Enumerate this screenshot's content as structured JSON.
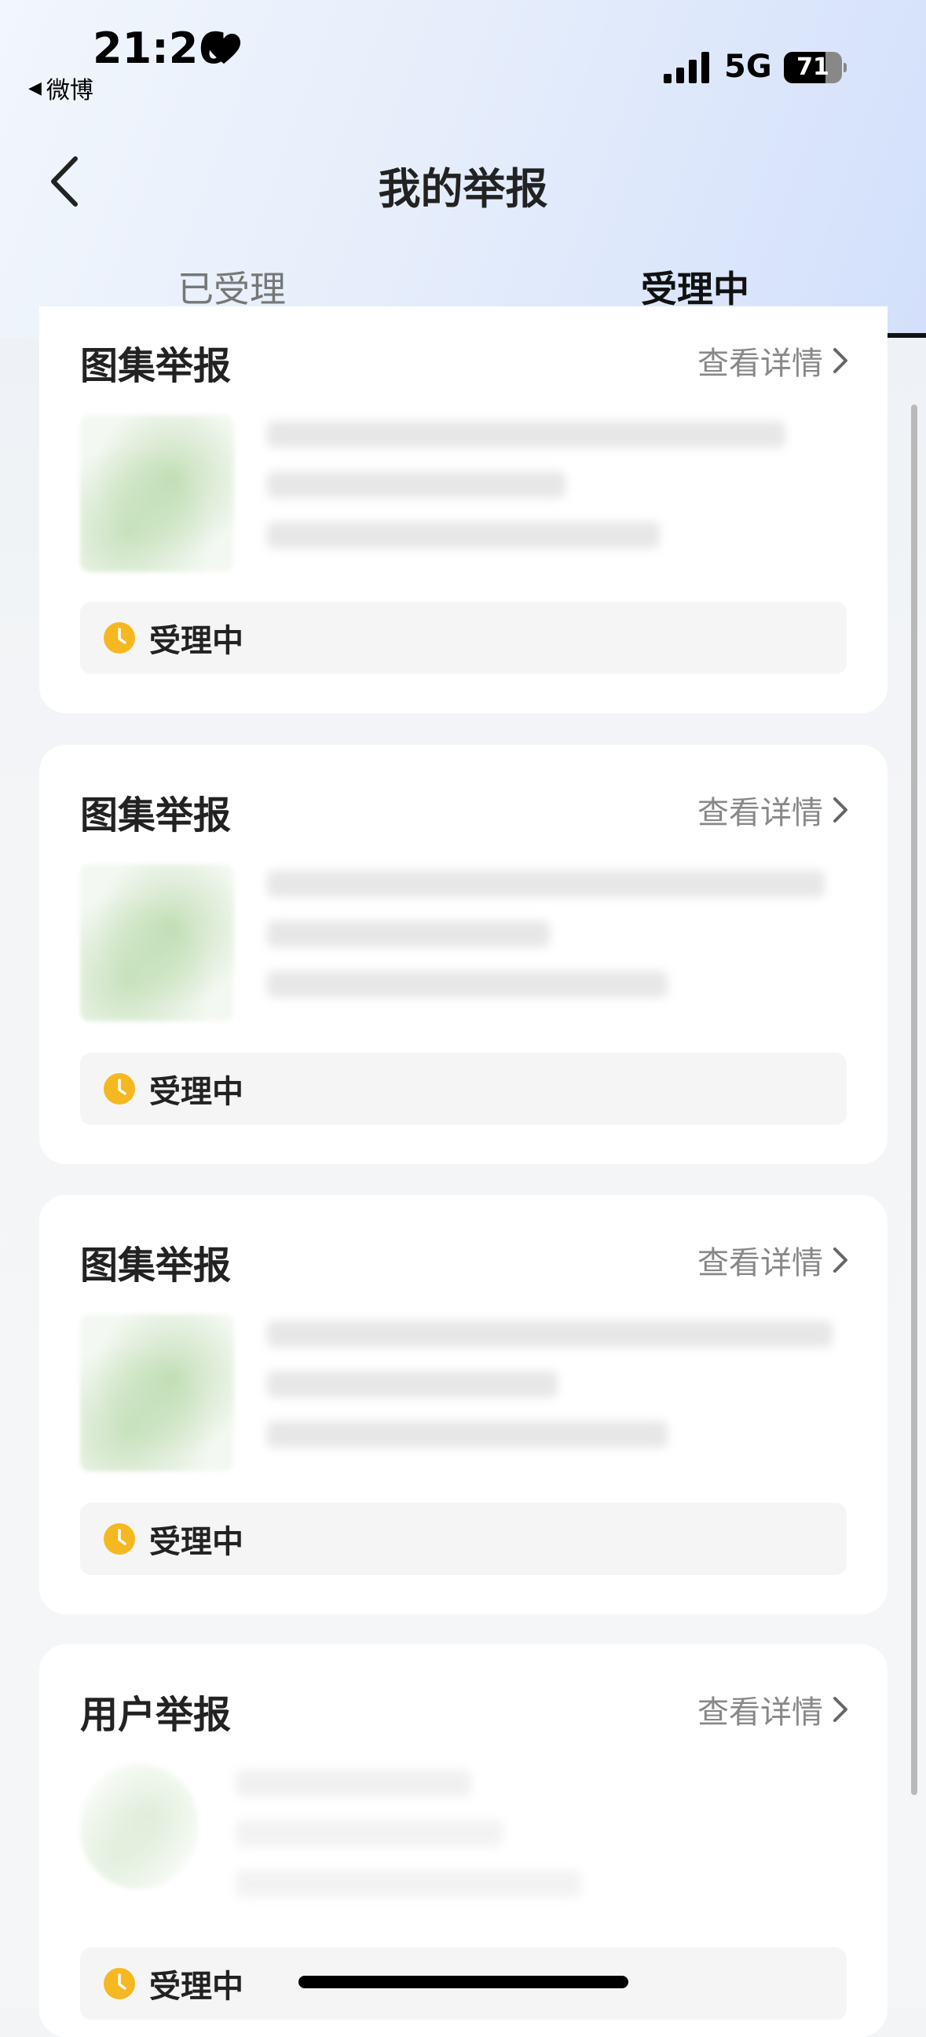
{
  "status_bar": {
    "time": "21:26",
    "back_app": "微博",
    "network": "5G",
    "battery": 71
  },
  "nav": {
    "title": "我的举报"
  },
  "tabs": [
    {
      "label": "已受理",
      "active": false
    },
    {
      "label": "受理中",
      "active": true
    }
  ],
  "cards": [
    {
      "title": "图集举报",
      "link": "查看详情",
      "status": "受理中"
    },
    {
      "title": "图集举报",
      "link": "查看详情",
      "status": "受理中"
    },
    {
      "title": "图集举报",
      "link": "查看详情",
      "status": "受理中"
    },
    {
      "title": "用户举报",
      "link": "查看详情",
      "status": "受理中"
    }
  ],
  "colors": {
    "status_icon": "#f5b820",
    "header_gradient_start": "#f2f6fd",
    "header_gradient_end": "#d3e0fb"
  }
}
